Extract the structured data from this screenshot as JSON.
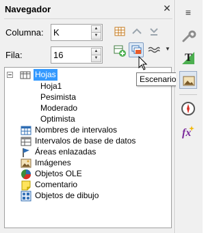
{
  "panel": {
    "title": "Navegador",
    "close_symbol": "✕"
  },
  "fields": {
    "column": {
      "label": "Columna:",
      "value": "K"
    },
    "row": {
      "label": "Fila:",
      "value": "16"
    }
  },
  "toolbar": {
    "icons": [
      "data-range-icon",
      "up-arrow-icon",
      "toggle-icon",
      "drag-mode-icon",
      "scenarios-icon",
      "document-select-icon"
    ]
  },
  "tooltip": {
    "text": "Escenarios"
  },
  "tree": {
    "root": {
      "label": "Hojas"
    },
    "sheets": [
      "Hoja1",
      "Pesimista",
      "Moderado",
      "Optimista"
    ],
    "categories": [
      {
        "label": "Nombres de intervalos",
        "icon": "range-names-icon"
      },
      {
        "label": "Intervalos de base de datos",
        "icon": "database-ranges-icon"
      },
      {
        "label": "Áreas enlazadas",
        "icon": "linked-areas-icon"
      },
      {
        "label": "Imágenes",
        "icon": "images-icon"
      },
      {
        "label": "Objetos OLE",
        "icon": "ole-objects-icon"
      },
      {
        "label": "Comentario",
        "icon": "comment-icon"
      },
      {
        "label": "Objetos de dibujo",
        "icon": "drawing-objects-icon"
      }
    ]
  },
  "colors": {
    "selection": "#3399ff",
    "panel_bg": "#f0f0f0"
  },
  "sidebar": {
    "menu_symbol": "≡",
    "icons": [
      "properties-icon",
      "styles-icon",
      "gallery-icon",
      "navigator-icon",
      "functions-icon"
    ]
  }
}
